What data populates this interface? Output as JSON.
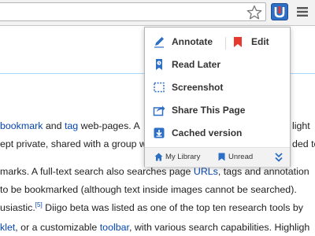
{
  "toolbar": {
    "icons": [
      "star-icon",
      "diigo-extension-icon",
      "hamburger-menu-icon"
    ],
    "accent_color": "#2c6fc5"
  },
  "page": {
    "lines": [
      {
        "parts": [
          {
            "text": "bookmark",
            "link": true
          },
          {
            "text": " and ",
            "link": false
          },
          {
            "text": "tag",
            "link": true
          },
          {
            "text": " web-pages. A",
            "link": false
          }
        ],
        "tail": "light"
      },
      {
        "parts": [
          {
            "text": "ept private, shared with a group w",
            "link": false
          }
        ],
        "tail": "ded to"
      },
      {
        "parts": [
          {
            "text": "marks. A full-text search also searches page ",
            "link": false
          },
          {
            "text": "URLs",
            "link": true
          },
          {
            "text": ", tags and annotation",
            "link": false
          }
        ]
      },
      {
        "parts": [
          {
            "text": "to be bookmarked (although text inside images cannot be searched).",
            "link": false
          }
        ]
      },
      {
        "parts": [
          {
            "text": "usiastic.",
            "link": false
          },
          {
            "text": "[5]",
            "link": true,
            "sup": true
          },
          {
            "text": " Diigo beta was listed as one of the top ten research tools by",
            "link": false
          }
        ]
      },
      {
        "parts": [
          {
            "text": "klet",
            "link": true
          },
          {
            "text": ", or a customizable ",
            "link": false
          },
          {
            "text": "toolbar",
            "link": true
          },
          {
            "text": ", with various search capabilities. Highligh",
            "link": false
          }
        ]
      }
    ]
  },
  "popup": {
    "annotate_label": "Annotate",
    "edit_label": "Edit",
    "items": [
      {
        "label": "Read Later",
        "icon": "read-later-icon"
      },
      {
        "label": "Screenshot",
        "icon": "screenshot-icon"
      },
      {
        "label": "Share This Page",
        "icon": "share-icon"
      },
      {
        "label": "Cached version",
        "icon": "cached-version-icon"
      }
    ],
    "footer": {
      "my_library": "My Library",
      "unread": "Unread"
    },
    "colors": {
      "edit_flag": "#e8392f",
      "icon_blue": "#2c6fc5"
    }
  }
}
